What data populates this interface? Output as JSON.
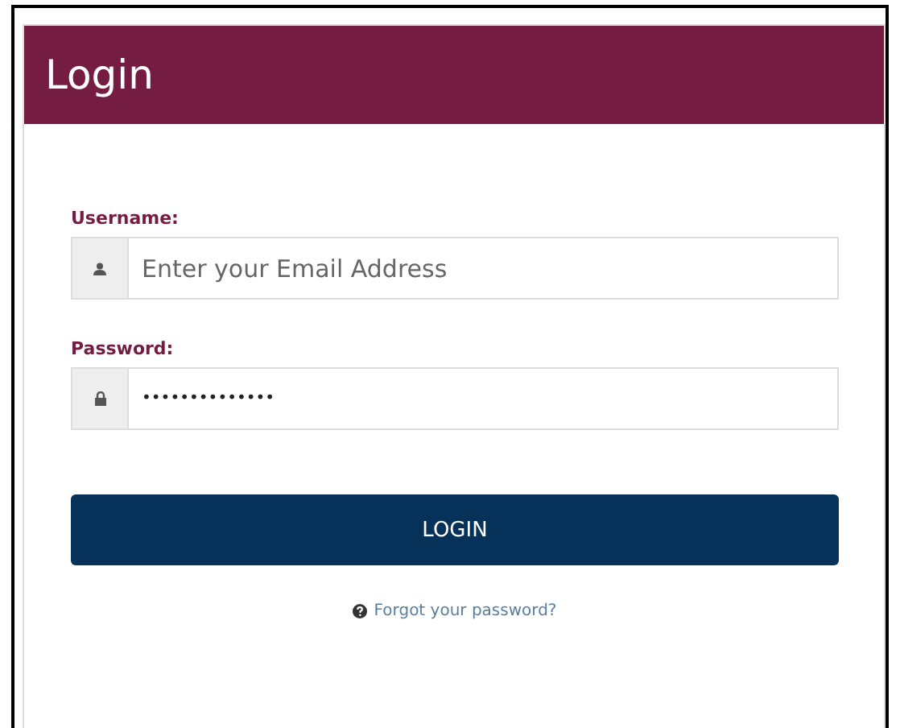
{
  "panel": {
    "title": "Login"
  },
  "fields": [
    {
      "label": "Username:",
      "kind": "user",
      "placeholder": "Enter your Email Address"
    },
    {
      "label": "Password:",
      "kind": "lock",
      "value": "••••••••••••••"
    }
  ],
  "button": "LOGIN",
  "forgot_link": "Forgot your password?"
}
